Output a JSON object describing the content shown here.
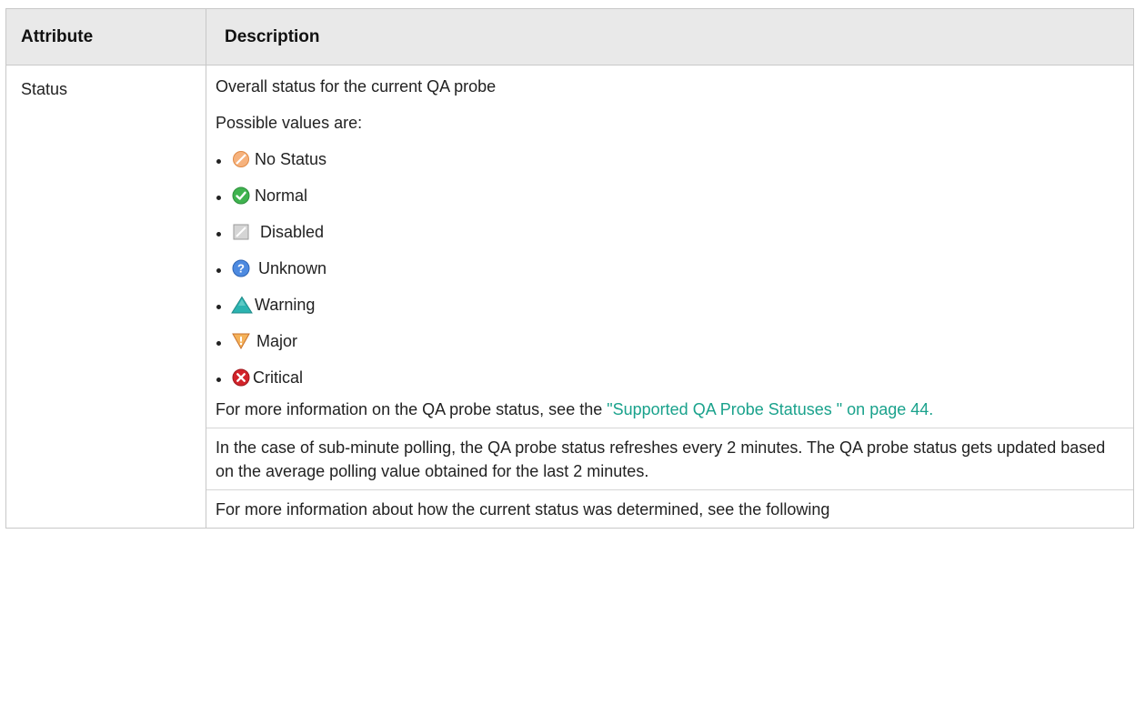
{
  "table": {
    "headers": {
      "attribute": "Attribute",
      "description": "Description"
    },
    "row": {
      "attribute": "Status",
      "overall": "Overall status for the current QA probe",
      "possible_intro": "Possible values are:",
      "values": [
        {
          "label": "No Status",
          "icon": "no-status-icon"
        },
        {
          "label": "Normal",
          "icon": "normal-icon"
        },
        {
          "label": "Disabled",
          "icon": "disabled-icon"
        },
        {
          "label": "Unknown",
          "icon": "unknown-icon"
        },
        {
          "label": "Warning",
          "icon": "warning-icon"
        },
        {
          "label": "Major",
          "icon": "major-icon"
        },
        {
          "label": "Critical",
          "icon": "critical-icon"
        }
      ],
      "more_info_prefix": "For more information on the QA probe status, see the ",
      "more_info_link": "\"Supported QA Probe Statuses \" on page 44.",
      "sub_minute_text": "In the case of sub-minute polling, the QA probe status refreshes every 2 minutes. The QA probe status gets updated based on the average polling value obtained for the last 2 minutes.",
      "how_determined_text": "For more information about how the current status was determined, see the following"
    }
  },
  "colors": {
    "header_bg": "#e9e9e9",
    "border": "#c8c8c8",
    "link": "#1aa28c",
    "normal": "#3fb34f",
    "unknown": "#3f7fd6",
    "warning": "#2bb3b0",
    "major": "#e58a2e",
    "critical": "#d2232a",
    "no_status": "#f0a060",
    "disabled": "#b9b9b9"
  }
}
